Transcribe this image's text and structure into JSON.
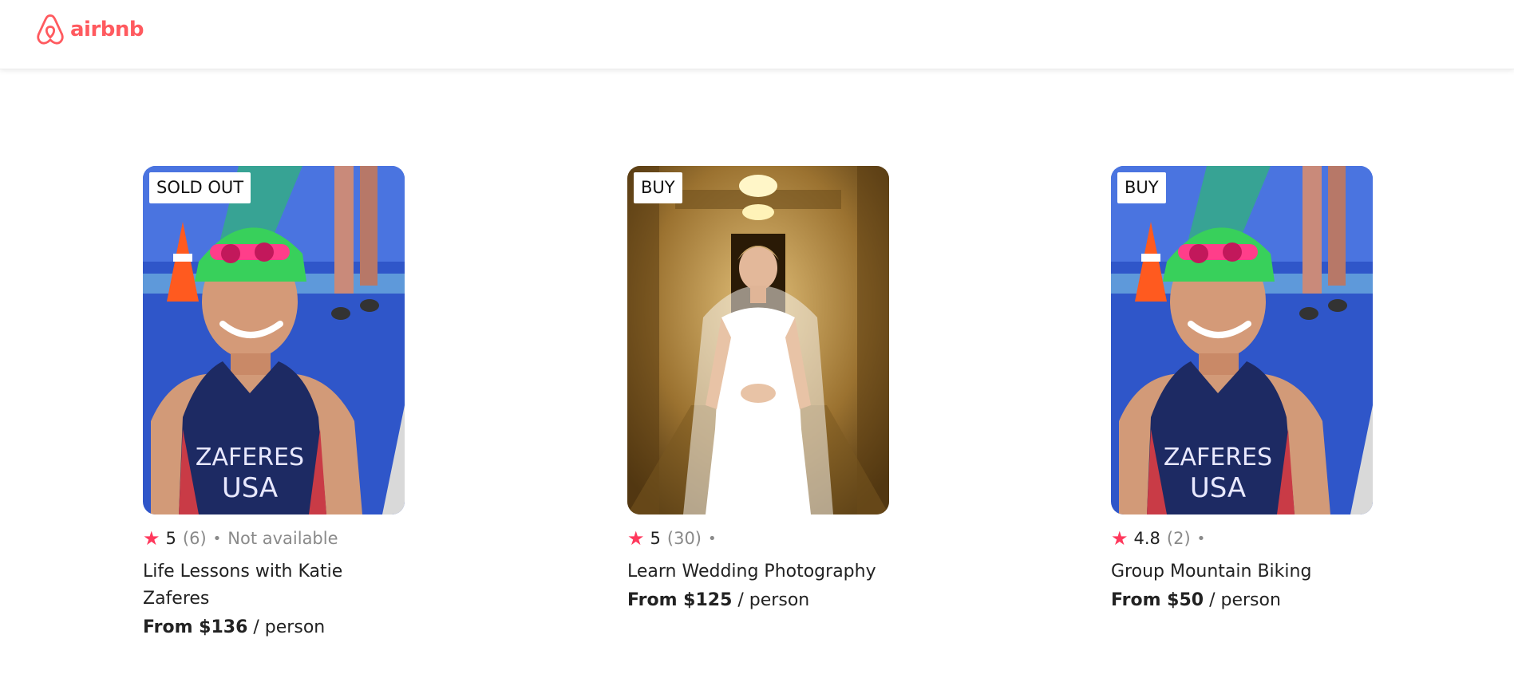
{
  "header": {
    "logo_text": "airbnb",
    "brand_color": "#FF5A5F"
  },
  "cards": [
    {
      "badge": "SOLD OUT",
      "image": "triathlete-portrait",
      "rating": "5",
      "review_count": "(6)",
      "separator": "•",
      "availability": "Not available",
      "title": "Life Lessons with Katie Zaferes",
      "price_label": "From $136",
      "price_unit": "/ person"
    },
    {
      "badge": "BUY",
      "image": "bride-portrait",
      "rating": "5",
      "review_count": "(30)",
      "separator": "•",
      "availability": "",
      "title": "Learn Wedding Photography",
      "price_label": "From $125",
      "price_unit": "/ person"
    },
    {
      "badge": "BUY",
      "image": "triathlete-portrait",
      "rating": "4.8",
      "review_count": "(2)",
      "separator": "•",
      "availability": "",
      "title": "Group Mountain Biking",
      "price_label": "From $50",
      "price_unit": "/ person"
    }
  ],
  "colors": {
    "star": "#FF385C",
    "muted_text": "#8a8a8a"
  },
  "jersey_text_line1": "ZAFERES",
  "jersey_text_line2": "USA"
}
